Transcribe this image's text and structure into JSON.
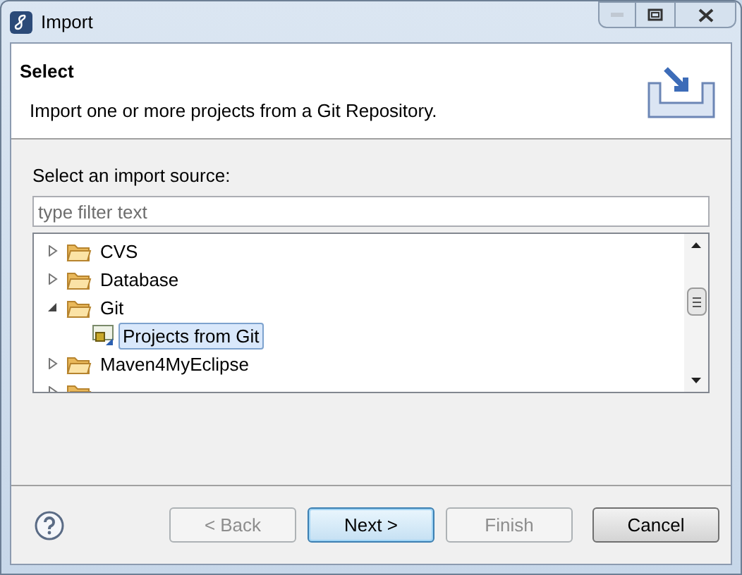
{
  "window": {
    "title": "Import"
  },
  "header": {
    "title": "Select",
    "description": "Import one or more projects from a Git Repository."
  },
  "source_label": "Select an import source:",
  "filter": {
    "placeholder": "type filter text"
  },
  "tree": [
    {
      "label": "CVS",
      "kind": "folder",
      "expanded": false,
      "selected": false
    },
    {
      "label": "Database",
      "kind": "folder",
      "expanded": false,
      "selected": false
    },
    {
      "label": "Git",
      "kind": "folder",
      "expanded": true,
      "selected": false,
      "children": [
        {
          "label": "Projects from Git",
          "kind": "wizard",
          "selected": true
        }
      ]
    },
    {
      "label": "Maven4MyEclipse",
      "kind": "folder",
      "expanded": false,
      "selected": false
    },
    {
      "kind": "folder",
      "expanded": false
    }
  ],
  "buttons": [
    {
      "label": "< Back",
      "disabled": true,
      "default": false
    },
    {
      "label": "Next >",
      "disabled": false,
      "default": true
    },
    {
      "label": "Finish",
      "disabled": true,
      "default": false
    },
    {
      "label": "Cancel",
      "disabled": false,
      "default": false
    }
  ]
}
